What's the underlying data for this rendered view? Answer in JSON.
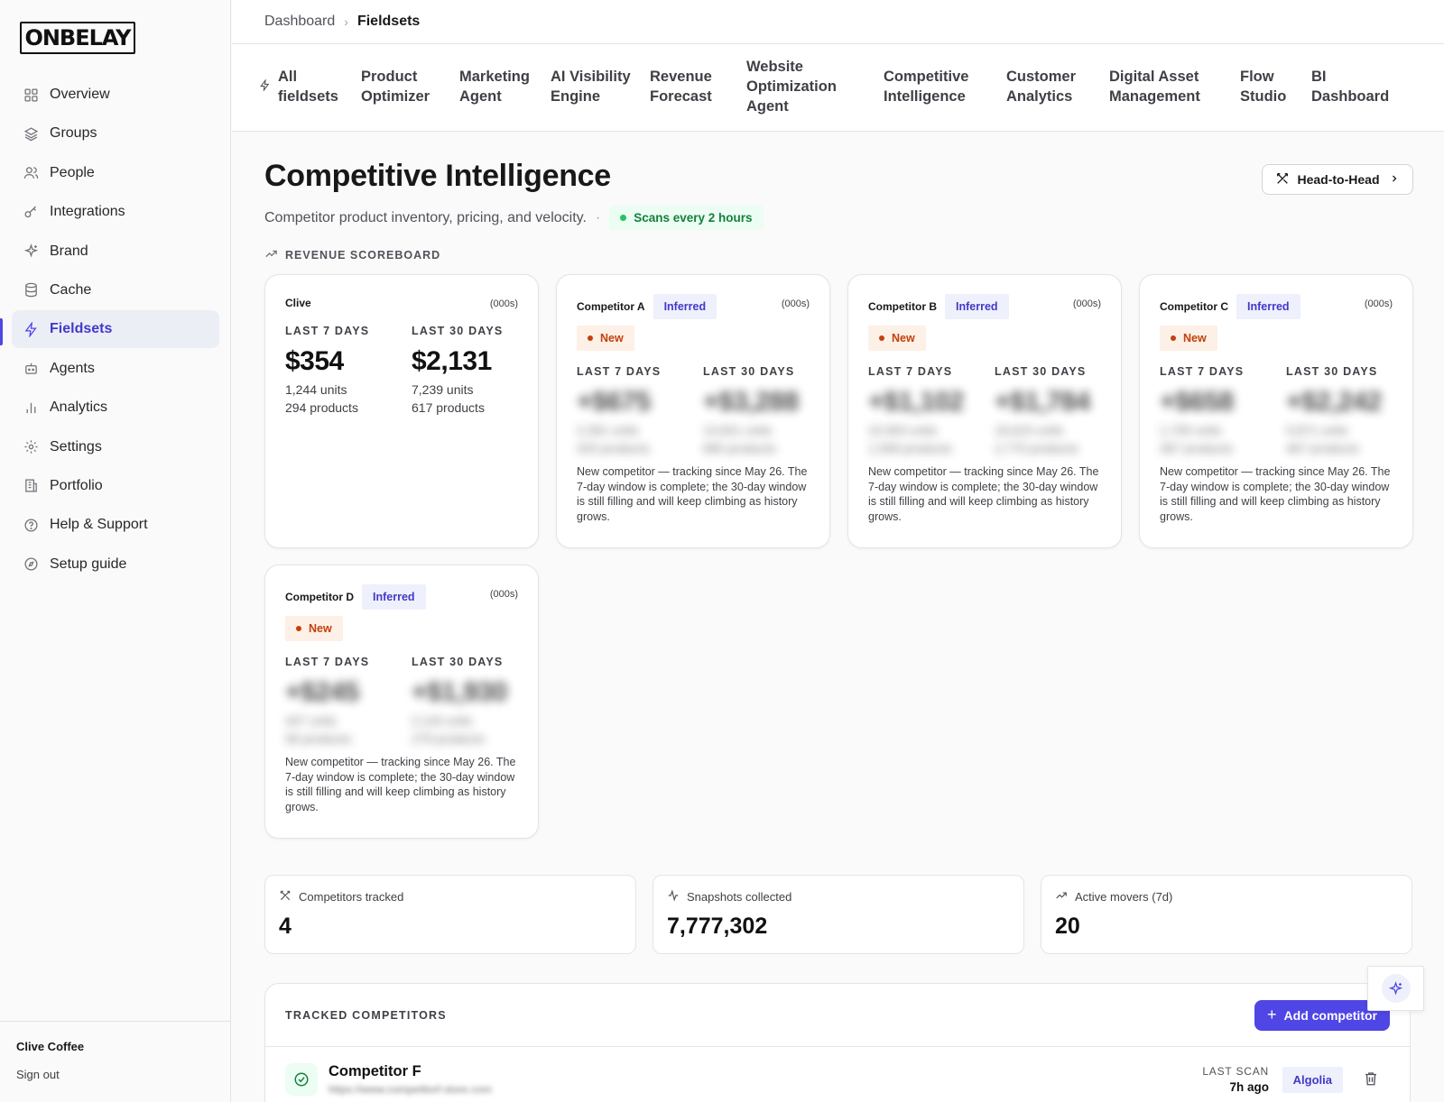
{
  "brand": {
    "logo_text": "ONBELAY"
  },
  "sidebar": {
    "items": [
      {
        "label": "Overview",
        "icon": "grid-icon"
      },
      {
        "label": "Groups",
        "icon": "layers-icon"
      },
      {
        "label": "People",
        "icon": "users-icon"
      },
      {
        "label": "Integrations",
        "icon": "key-icon"
      },
      {
        "label": "Brand",
        "icon": "sparkles-icon"
      },
      {
        "label": "Cache",
        "icon": "database-icon"
      },
      {
        "label": "Fieldsets",
        "icon": "bolt-icon",
        "active": true
      },
      {
        "label": "Agents",
        "icon": "bot-icon"
      },
      {
        "label": "Analytics",
        "icon": "bar-chart-icon"
      },
      {
        "label": "Settings",
        "icon": "gear-icon"
      },
      {
        "label": "Portfolio",
        "icon": "building-icon"
      },
      {
        "label": "Help & Support",
        "icon": "help-circle-icon"
      },
      {
        "label": "Setup guide",
        "icon": "compass-icon"
      }
    ],
    "footer": {
      "org": "Clive Coffee",
      "signout": "Sign out"
    }
  },
  "breadcrumb": {
    "parent": "Dashboard",
    "current": "Fieldsets"
  },
  "tabs": [
    {
      "label": "All fieldsets"
    },
    {
      "label": "Product Optimizer"
    },
    {
      "label": "Marketing Agent"
    },
    {
      "label": "AI Visibility Engine"
    },
    {
      "label": "Revenue Forecast"
    },
    {
      "label": "Website Optimization Agent"
    },
    {
      "label": "Competitive Intelligence"
    },
    {
      "label": "Customer Analytics"
    },
    {
      "label": "Digital Asset Management"
    },
    {
      "label": "Flow Studio"
    },
    {
      "label": "BI Dashboard"
    }
  ],
  "page": {
    "title": "Competitive Intelligence",
    "subtitle": "Competitor product inventory, pricing, and velocity.",
    "dot": "·",
    "scan_badge": "Scans every 2 hours",
    "head_to_head": "Head-to-Head",
    "section_label": "REVENUE SCOREBOARD"
  },
  "scoreboard": {
    "unit_label": "(000s)",
    "label_7d": "LAST 7 DAYS",
    "label_30d": "LAST 30 DAYS",
    "inferred_label": "Inferred",
    "new_label": "New",
    "note": "New competitor — tracking since May 26. The 7-day window is complete; the 30-day window is still filling and will keep climbing as history grows.",
    "cards": [
      {
        "name": "Clive",
        "v7": "$354",
        "u7": "1,244 units",
        "p7": "294 products",
        "v30": "$2,131",
        "u30": "7,239 units",
        "p30": "617 products"
      },
      {
        "name": "Competitor A",
        "v7": "+$675",
        "u7": "2,391 units",
        "p7": "325 products",
        "v30": "+$3,288",
        "u30": "13,821 units",
        "p30": "685 products"
      },
      {
        "name": "Competitor B",
        "v7": "+$1,102",
        "u7": "10,903 units",
        "p7": "1,508 products",
        "v30": "+$1,784",
        "u30": "18,615 units",
        "p30": "2,775 products"
      },
      {
        "name": "Competitor C",
        "v7": "+$658",
        "u7": "1,705 units",
        "p7": "367 products",
        "v30": "+$2,242",
        "u30": "5,871 units",
        "p30": "467 products"
      },
      {
        "name": "Competitor D",
        "v7": "+$245",
        "u7": "447 units",
        "p7": "58 products",
        "v30": "+$1,930",
        "u30": "2,116 units",
        "p30": "279 products"
      }
    ]
  },
  "stats": [
    {
      "label": "Competitors tracked",
      "value": "4",
      "icon": "swords-icon"
    },
    {
      "label": "Snapshots collected",
      "value": "7,777,302",
      "icon": "activity-icon"
    },
    {
      "label": "Active movers (7d)",
      "value": "20",
      "icon": "trending-up-icon"
    }
  ],
  "tracked": {
    "label": "TRACKED COMPETITORS",
    "add_button": "Add competitor",
    "rows": [
      {
        "name": "Competitor F",
        "url": "https://www.competitorf-store.com",
        "last_scan_label": "LAST SCAN",
        "last_scan": "7h ago",
        "source": "Algolia"
      }
    ]
  }
}
